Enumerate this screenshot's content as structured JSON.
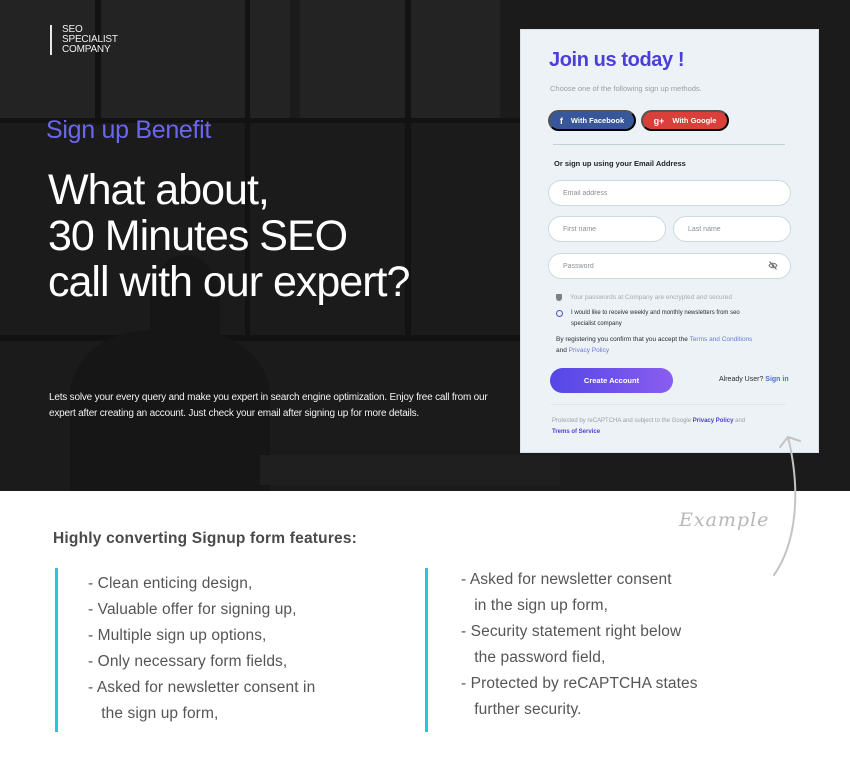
{
  "hero": {
    "logo_lines": [
      "SEO",
      "SPECIALIST",
      "COMPANY"
    ],
    "benefit_label": "Sign up Benefit",
    "headline_lines": [
      "What about,",
      "30 Minutes SEO",
      "call with our expert?"
    ],
    "description": "Lets solve your every query and make you expert in search engine optimization. Enjoy free call from our expert after creating an account. Just check your email after signing up for more details."
  },
  "signup_card": {
    "title": "Join us today !",
    "subtitle": "Choose one of the following sign up methods.",
    "facebook_button": {
      "label": "With Facebook",
      "icon": "facebook-icon",
      "glyph": "f",
      "color": "#37579a"
    },
    "google_button": {
      "label": "With Google",
      "icon": "google-plus-icon",
      "glyph": "g+",
      "color": "#d9403a"
    },
    "or_label": "Or sign up using your Email Address",
    "fields": {
      "email": {
        "placeholder": "Email address",
        "value": ""
      },
      "first_name": {
        "placeholder": "First name",
        "value": ""
      },
      "last_name": {
        "placeholder": "Last name",
        "value": ""
      },
      "password": {
        "placeholder": "Password",
        "value": "",
        "toggle_icon": "eye-slash-icon"
      }
    },
    "security_note": "Your passwords at Company are encrypted and secured",
    "newsletter_consent": "I would like to receive weekly and monthly newsletters from seo specialist company",
    "terms_prefix": "By registering you confirm that you accept the ",
    "terms_link": "Terms and Conditions",
    "terms_and": "and ",
    "privacy_link": "Privacy Policy",
    "create_button": "Create Account",
    "already_user": "Already User? ",
    "sign_in_link": "Sign in",
    "recaptcha_prefix": "Protected by reCAPTCHA and subject to the Google ",
    "recaptcha_privacy": "Privacy Policy",
    "recaptcha_and": " and",
    "recaptcha_terms": "Trems of Service",
    "accent_color": "#4b3fd8"
  },
  "annotation": {
    "label": "Example"
  },
  "features": {
    "title": "Highly converting Signup form features:",
    "left_items": [
      "- Clean enticing design,",
      "- Valuable offer for signing up,",
      "- Multiple sign up options,",
      "- Only necessary form fields,",
      "- Asked for newsletter consent in",
      "   the sign up form,"
    ],
    "right_items": [
      "- Asked for newsletter consent",
      "   in the sign up form,",
      "- Security statement right below",
      "   the password field,",
      "- Protected by reCAPTCHA states",
      "   further security."
    ],
    "accent_color": "#23c8da"
  }
}
